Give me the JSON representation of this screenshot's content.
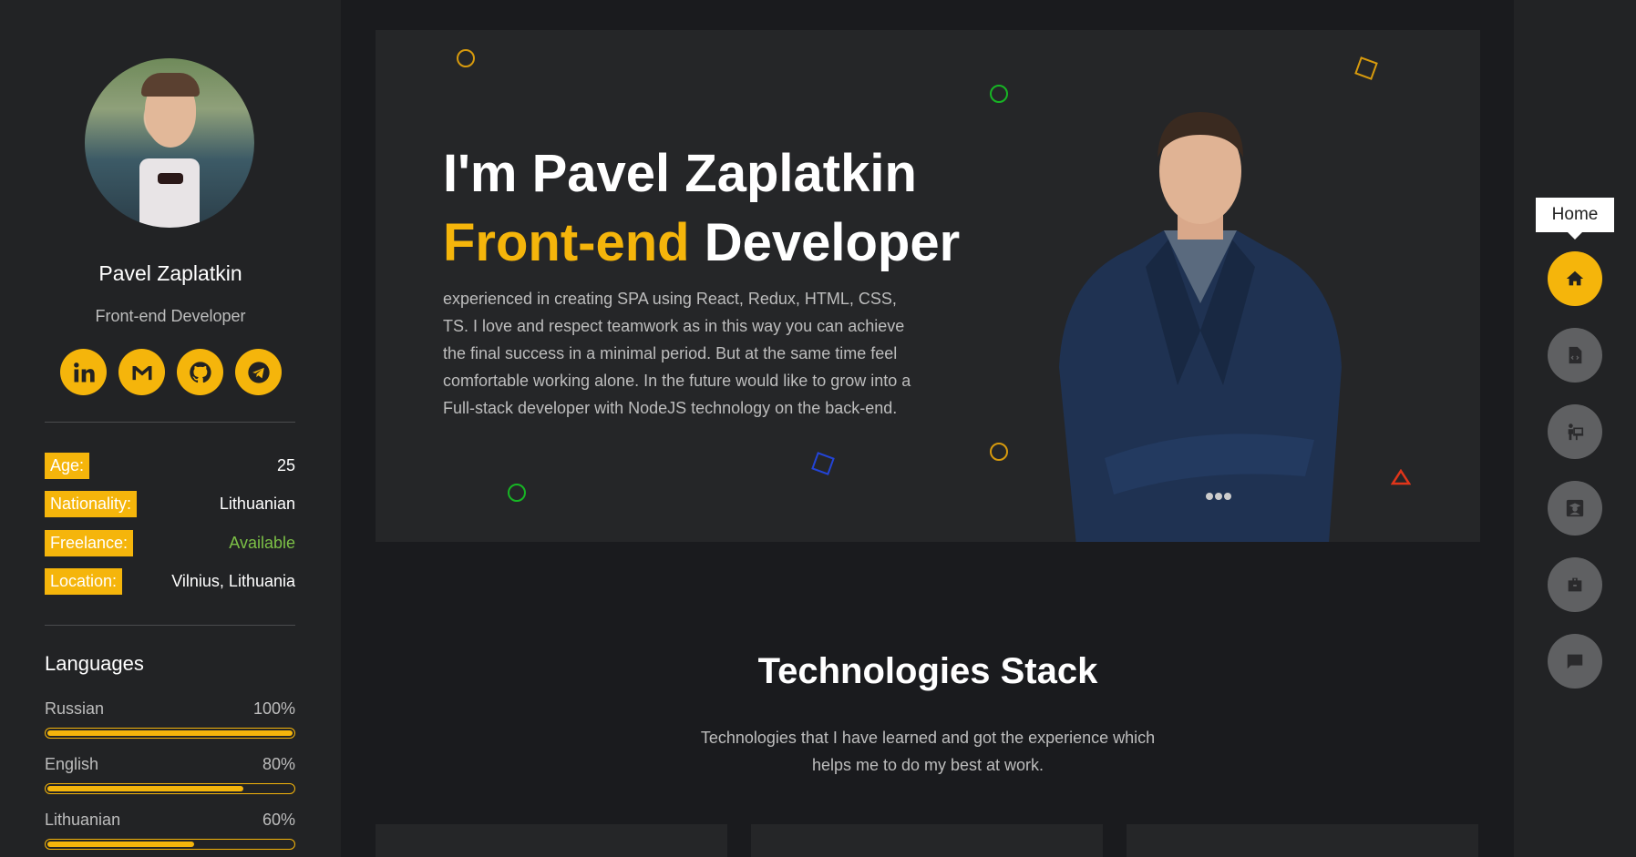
{
  "sidebar": {
    "name": "Pavel Zaplatkin",
    "role": "Front-end Developer",
    "socials": [
      "linkedin-icon",
      "gmail-icon",
      "github-icon",
      "telegram-icon"
    ],
    "info": [
      {
        "key": "Age:",
        "value": "25"
      },
      {
        "key": "Nationality:",
        "value": "Lithuanian"
      },
      {
        "key": "Freelance:",
        "value": "Available"
      },
      {
        "key": "Location:",
        "value": "Vilnius, Lithuania"
      }
    ],
    "languages_title": "Languages",
    "languages": [
      {
        "name": "Russian",
        "percent_label": "100%",
        "level": 1.0
      },
      {
        "name": "English",
        "percent_label": "80%",
        "level": 0.8
      },
      {
        "name": "Lithuanian",
        "percent_label": "60%",
        "level": 0.6
      }
    ]
  },
  "hero": {
    "line1": "I'm Pavel Zaplatkin",
    "line2_accent": "Front-end",
    "line2_rest": " Developer",
    "description": "experienced in creating SPA using React, Redux, HTML, CSS, TS. I love and respect teamwork as in this way you can achieve the final success in a minimal period. But at the same time feel comfortable working alone. In the future would like to grow into a Full-stack developer with NodeJS technology on the back-end."
  },
  "stack": {
    "title": "Technologies Stack",
    "subtitle": "Technologies that I have learned and got the experience which helps me to do my best at work."
  },
  "nav": {
    "tooltip": "Home",
    "items": [
      "home-icon",
      "resume-icon",
      "portfolio-icon",
      "education-icon",
      "experience-icon",
      "contact-icon"
    ]
  },
  "colors": {
    "accent": "#f5b50b",
    "available": "#7cc046",
    "background": "#1a1b1e",
    "panel": "#252628"
  }
}
